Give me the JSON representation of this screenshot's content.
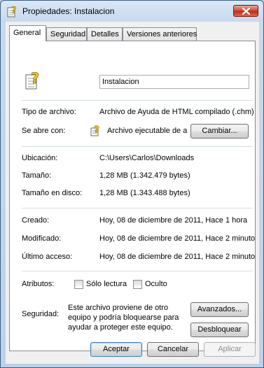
{
  "window": {
    "title": "Propiedades: Instalacion"
  },
  "tabs": [
    {
      "label": "General",
      "active": true
    },
    {
      "label": "Seguridad",
      "active": false
    },
    {
      "label": "Detalles",
      "active": false
    },
    {
      "label": "Versiones anteriores",
      "active": false
    }
  ],
  "general": {
    "name_value": "Instalacion",
    "file_type_label": "Tipo de archivo:",
    "file_type_value": "Archivo de Ayuda de HTML compilado (.chm)",
    "opens_with_label": "Se abre con:",
    "opens_with_value": "Archivo ejecutable de a",
    "change_button": "Cambiar...",
    "location_label": "Ubicación:",
    "location_value": "C:\\Users\\Carlos\\Downloads",
    "size_label": "Tamaño:",
    "size_value": "1,28 MB (1.342.479 bytes)",
    "disk_size_label": "Tamaño en disco:",
    "disk_size_value": "1,28 MB (1.343.488 bytes)",
    "created_label": "Creado:",
    "created_value": "Hoy, 08 de diciembre de 2011, Hace 1 hora",
    "modified_label": "Modificado:",
    "modified_value": "Hoy, 08 de diciembre de 2011, Hace 2 minuto",
    "accessed_label": "Último acceso:",
    "accessed_value": "Hoy, 08 de diciembre de 2011, Hace 2 minuto",
    "attributes_label": "Atributos:",
    "readonly_label": "Sólo lectura",
    "readonly_checked": false,
    "hidden_label": "Oculto",
    "hidden_checked": false,
    "security_label": "Seguridad:",
    "security_text_1": "Este archivo proviene de otro",
    "security_text_2": "equipo y podría bloquearse para",
    "security_text_3": "ayudar a proteger este equipo.",
    "advanced_button": "Avanzados...",
    "unblock_button": "Desbloquear"
  },
  "footer": {
    "accept_button": "Aceptar",
    "cancel_button": "Cancelar",
    "apply_button": "Aplicar"
  },
  "icons": {
    "title": "chm-help-file-icon",
    "file": "chm-help-file-icon",
    "program": "help-program-icon"
  }
}
